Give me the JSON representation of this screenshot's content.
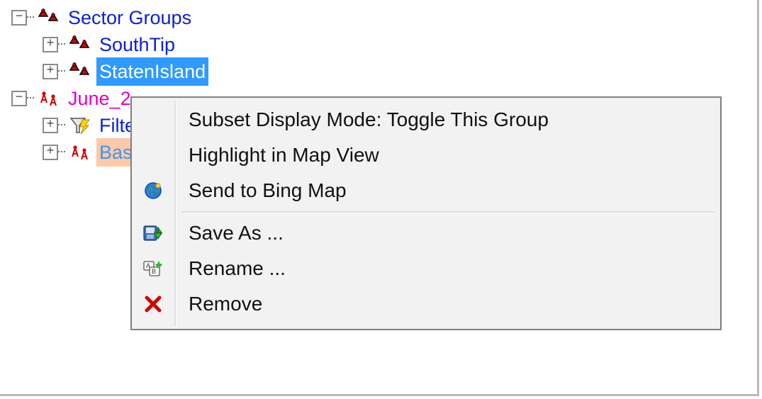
{
  "tree": {
    "root1": {
      "label": "Sector Groups",
      "children": [
        {
          "label": "SouthTip"
        },
        {
          "label": "StatenIsland",
          "selected": true
        }
      ]
    },
    "root2": {
      "label_partial": "June_2",
      "children": [
        {
          "label_partial": "Filte"
        },
        {
          "label_partial": "Base",
          "highlighted": true
        }
      ]
    }
  },
  "context_menu": {
    "items": [
      {
        "icon": "",
        "label": "Subset Display Mode: Toggle This Group"
      },
      {
        "icon": "",
        "label": "Highlight in Map View"
      },
      {
        "icon": "globe-icon",
        "label": "Send to Bing Map"
      },
      {
        "separator": true
      },
      {
        "icon": "save-icon",
        "label": "Save As ..."
      },
      {
        "icon": "rename-icon",
        "label": "Rename ..."
      },
      {
        "icon": "remove-icon",
        "label": "Remove"
      }
    ]
  },
  "glyphs": {
    "plus": "+",
    "minus": "−"
  }
}
